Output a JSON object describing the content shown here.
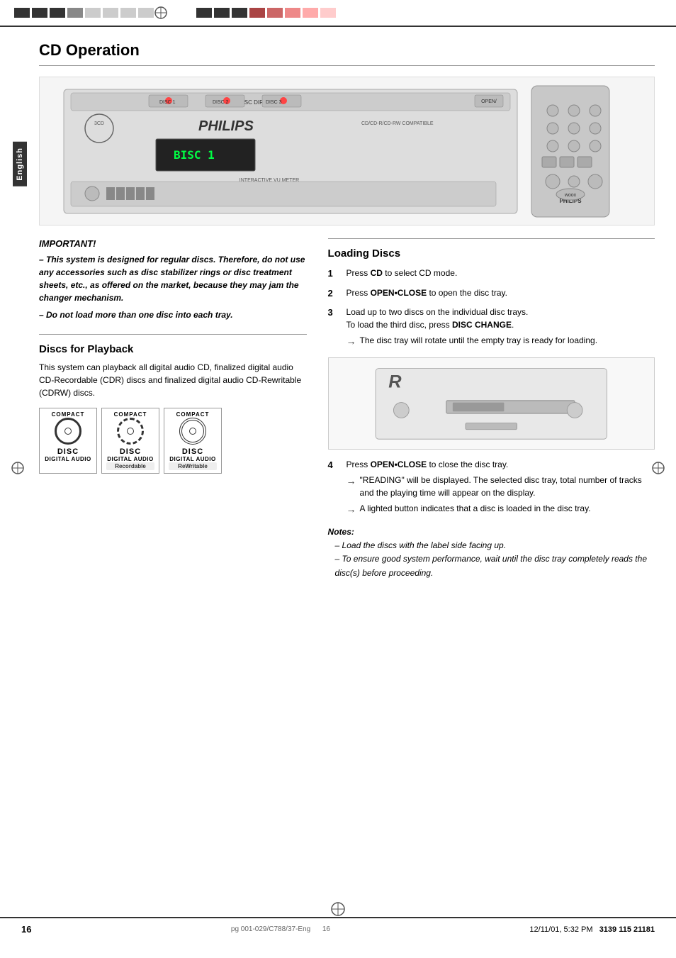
{
  "page": {
    "title": "CD Operation",
    "page_number": "16",
    "doc_id": "pg 001-029/C788/37-Eng",
    "doc_page": "16",
    "timestamp": "12/11/01, 5:32 PM",
    "barcode": "3139 115 21181"
  },
  "side_tab": {
    "label": "English"
  },
  "important_section": {
    "title": "IMPORTANT!",
    "points": [
      "– This system is designed for regular discs. Therefore, do not use any accessories such as disc stabilizer rings or disc treatment sheets, etc., as offered on the market, because they may jam the changer mechanism.",
      "– Do not load more than one disc into each tray."
    ]
  },
  "discs_for_playback": {
    "title": "Discs for Playback",
    "text": "This system can playback all digital audio CD, finalized digital audio CD-Recordable (CDR) discs and finalized digital audio CD-Rewritable (CDRW) discs.",
    "disc_types": [
      {
        "top_label": "COMPACT",
        "middle_label": "disc",
        "bottom_label": "DIGITAL AUDIO",
        "extra": ""
      },
      {
        "top_label": "COMPACT",
        "middle_label": "disc",
        "bottom_label": "DIGITAL AUDIO",
        "extra": "Recordable"
      },
      {
        "top_label": "COMPACT",
        "middle_label": "disc",
        "bottom_label": "DIGITAL AUDIO",
        "extra": "ReWritable"
      }
    ]
  },
  "loading_discs": {
    "title": "Loading Discs",
    "steps": [
      {
        "num": "1",
        "text": "Press CD to select CD mode.",
        "bold_parts": [
          "CD"
        ]
      },
      {
        "num": "2",
        "text": "Press OPEN•CLOSE to open the disc tray.",
        "bold_parts": [
          "OPEN•CLOSE"
        ]
      },
      {
        "num": "3",
        "text": "Load up to two discs on the individual disc trays.\nTo load the third disc, press DISC CHANGE.",
        "bold_parts": [
          "DISC CHANGE"
        ],
        "arrow": "The disc tray will rotate until the empty tray is ready for loading."
      },
      {
        "num": "4",
        "text": "Press OPEN•CLOSE to close the disc tray.",
        "bold_parts": [
          "OPEN•CLOSE"
        ],
        "arrows": [
          "\"READING\" will be displayed. The selected disc tray, total number of tracks and the playing time will appear on the display.",
          "A lighted button indicates that a disc is loaded in the disc tray."
        ]
      }
    ]
  },
  "notes": {
    "title": "Notes:",
    "items": [
      "– Load the discs with the label side facing up.",
      "– To ensure good system performance, wait until the disc tray completely reads the disc(s) before proceeding."
    ]
  },
  "device_alt": "Philips 3CD stereo system front panel",
  "remote_alt": "Philips remote control"
}
